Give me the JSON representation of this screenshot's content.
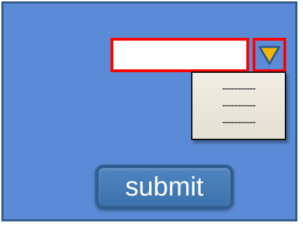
{
  "form": {
    "input_value": "",
    "input_placeholder": "",
    "dropdown_icon": "triangle-down-icon",
    "options": [
      "-----------",
      "-----------",
      "-----------"
    ],
    "submit_label": "submit"
  },
  "colors": {
    "background": "#5b8bd6",
    "frame_border": "#325a8a",
    "input_border": "#ff0000",
    "arrow_fill": "#f5b400",
    "arrow_stroke": "#325a8a",
    "dropdown_background": "#eeeae0",
    "button_background": "#4f84be"
  }
}
